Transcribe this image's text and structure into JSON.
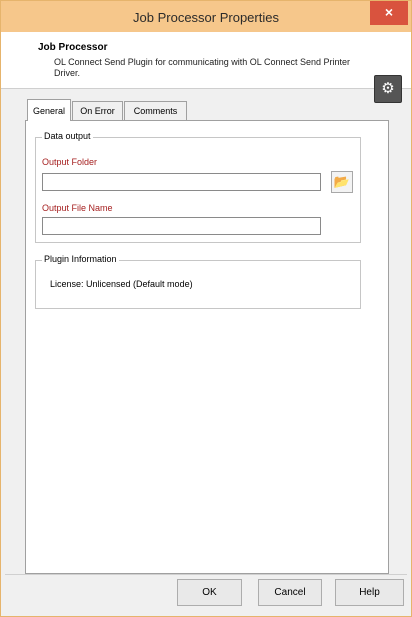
{
  "window": {
    "title": "Job Processor Properties",
    "close_glyph": "×"
  },
  "header": {
    "title": "Job Processor",
    "description": "OL Connect Send Plugin for communicating with OL Connect Send Printer Driver.",
    "icon": "plugin-gear-icon"
  },
  "tabs": [
    {
      "label": "General",
      "active": true
    },
    {
      "label": "On Error",
      "active": false
    },
    {
      "label": "Comments",
      "active": false
    }
  ],
  "data_output": {
    "legend": "Data output",
    "folder_label": "Output Folder",
    "folder_value": "",
    "file_label": "Output File Name",
    "file_value": ""
  },
  "plugin_info": {
    "legend": "Plugin Information",
    "license_text": "License: Unlicensed (Default mode)"
  },
  "buttons": {
    "ok": "OK",
    "cancel": "Cancel",
    "help": "Help"
  },
  "colors": {
    "titlebar": "#f6c78b",
    "close": "#d9533e",
    "label_red": "#a51f1f"
  }
}
